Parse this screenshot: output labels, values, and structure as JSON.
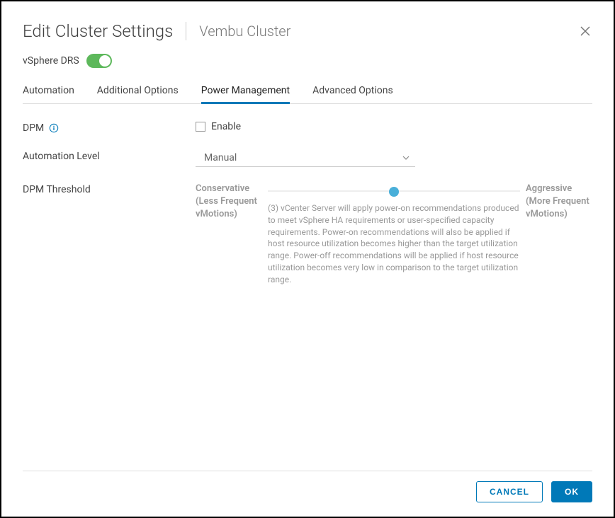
{
  "header": {
    "title": "Edit Cluster Settings",
    "subtitle": "Vembu Cluster"
  },
  "drs": {
    "label": "vSphere DRS",
    "enabled": true
  },
  "tabs": {
    "items": [
      {
        "label": "Automation",
        "active": false
      },
      {
        "label": "Additional Options",
        "active": false
      },
      {
        "label": "Power Management",
        "active": true
      },
      {
        "label": "Advanced Options",
        "active": false
      }
    ]
  },
  "form": {
    "dpm": {
      "label": "DPM",
      "enable_label": "Enable",
      "enabled": false
    },
    "automation_level": {
      "label": "Automation Level",
      "value": "Manual"
    },
    "threshold": {
      "label": "DPM Threshold",
      "left_label": "Conservative (Less Frequent vMotions)",
      "right_label": "Aggressive (More Frequent vMotions)",
      "value_percent": 50,
      "description": "(3) vCenter Server will apply power-on recommendations produced to meet vSphere HA requirements or user-specified capacity requirements. Power-on recommendations will also be applied if host resource utilization becomes higher than the target utilization range. Power-off recommendations will be applied if host resource utilization becomes very low in comparison to the target utilization range."
    }
  },
  "footer": {
    "cancel": "CANCEL",
    "ok": "OK"
  }
}
